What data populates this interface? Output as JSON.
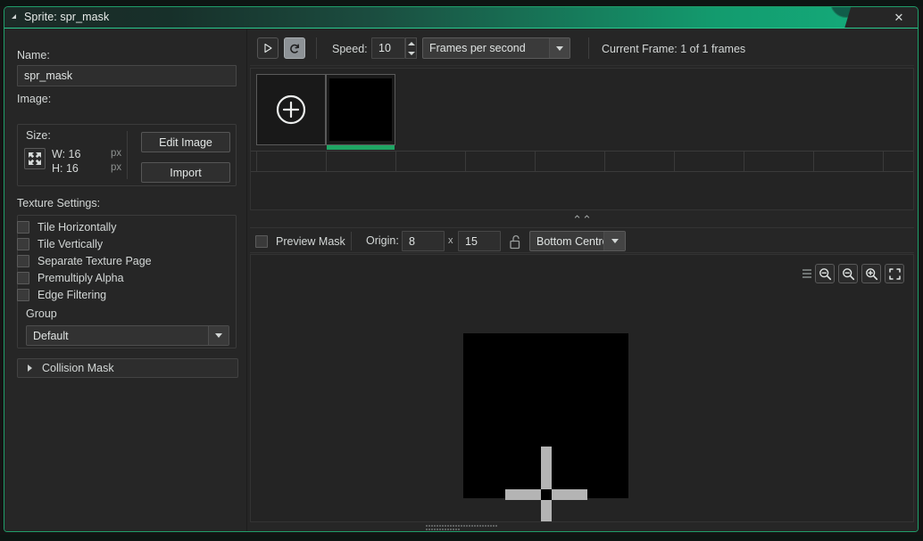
{
  "window": {
    "title": "Sprite: spr_mask",
    "collapse_icon": "triangle-collapse-icon",
    "close_label": "✕"
  },
  "left_panel": {
    "name_label": "Name:",
    "name_value": "spr_mask",
    "image_label": "Image:",
    "size_label": "Size:",
    "size_icon": "resize-arrows-icon",
    "width_text": "W: 16",
    "height_text": "H: 16",
    "unit_w": "px",
    "unit_h": "px",
    "edit_image_label": "Edit Image",
    "import_label": "Import",
    "texture_settings_label": "Texture Settings:",
    "checkboxes": [
      {
        "label": "Tile Horizontally",
        "checked": false
      },
      {
        "label": "Tile Vertically",
        "checked": false
      },
      {
        "label": "Separate Texture Page",
        "checked": false
      },
      {
        "label": "Premultiply Alpha",
        "checked": false
      },
      {
        "label": "Edge Filtering",
        "checked": false
      }
    ],
    "group_label": "Group",
    "group_value": "Default",
    "collision_mask_label": "Collision Mask"
  },
  "anim_toolbar": {
    "play_icon": "play-icon",
    "loop_icon": "loop-icon",
    "loop_active": true,
    "speed_label": "Speed:",
    "speed_value": "10",
    "speed_units_value": "Frames per second",
    "current_frame_text": "Current Frame: 1 of 1 frames"
  },
  "frames": {
    "add_frame_icon": "add-circle-icon",
    "thumbnails": [
      {
        "name": "frame-1",
        "selected": true,
        "color": "#000000"
      }
    ]
  },
  "origin_bar": {
    "preview_mask_label": "Preview Mask",
    "preview_mask_checked": false,
    "origin_label": "Origin:",
    "origin_x": "8",
    "origin_sep": "x",
    "origin_y": "15",
    "lock_icon": "unlocked-padlock-icon",
    "origin_preset_value": "Bottom Centre"
  },
  "canvas": {
    "sprite_color": "#000000",
    "crosshair_color": "#b4b4b4",
    "tools": [
      {
        "name": "drag-grip",
        "icon": "grip-icon"
      },
      {
        "name": "zoom-out-button",
        "icon": "magnifier-minus-icon"
      },
      {
        "name": "zoom-reset-button",
        "icon": "magnifier-minus-icon"
      },
      {
        "name": "zoom-in-button",
        "icon": "magnifier-plus-icon"
      },
      {
        "name": "fit-to-window-button",
        "icon": "expand-brackets-icon"
      }
    ]
  },
  "theme": {
    "accent_green": "#1fa564",
    "titlebar_green": "#14b07e",
    "panel_bg": "#262626",
    "card_bg": "#242424"
  }
}
